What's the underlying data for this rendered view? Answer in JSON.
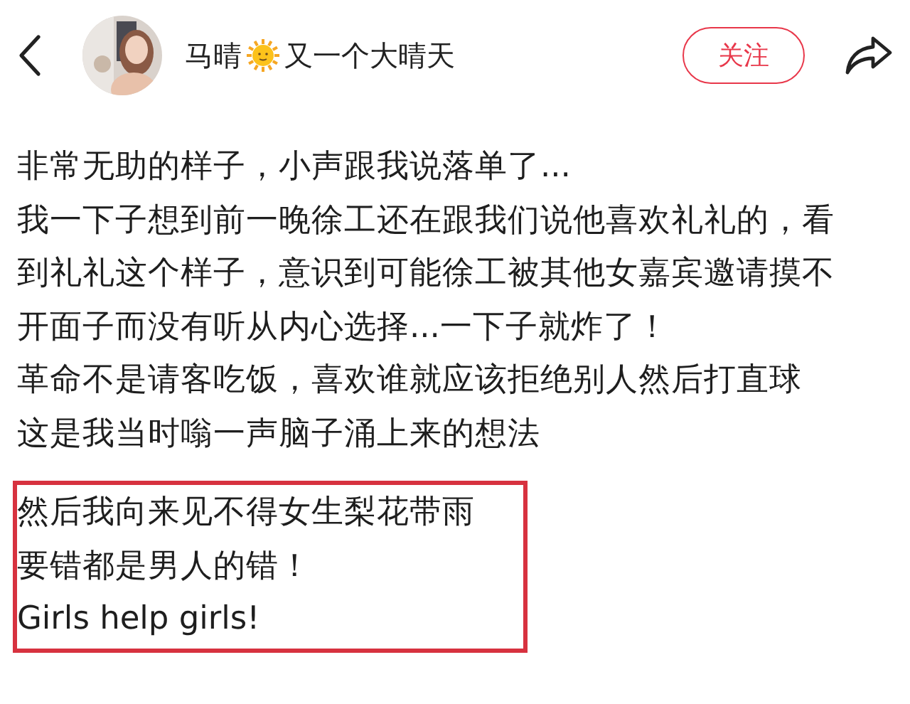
{
  "header": {
    "author_name": "马晴",
    "author_suffix": "又一个大晴天",
    "follow_button": "关注"
  },
  "lines": [
    "非常无助的样子，小声跟我说落单了...",
    "我一下子想到前一晚徐工还在跟我们说他喜欢礼礼的，看",
    "到礼礼这个样子，意识到可能徐工被其他女嘉宾邀请摸不",
    "开面子而没有听从内心选择...一下子就炸了！",
    "革命不是请客吃饭，喜欢谁就应该拒绝别人然后打直球",
    "这是我当时嗡一声脑子涌上来的想法"
  ],
  "highlighted_lines": [
    "然后我向来见不得女生梨花带雨",
    "要错都是男人的错！",
    "Girls help girls!"
  ]
}
